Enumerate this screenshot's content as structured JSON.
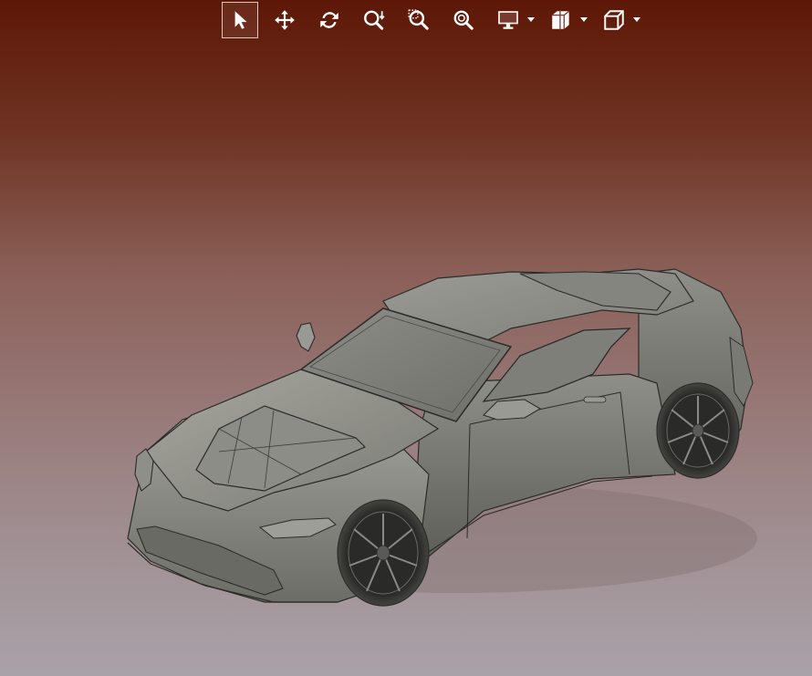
{
  "toolbar": {
    "tools": [
      {
        "id": "select",
        "icon": "cursor-icon",
        "active": true
      },
      {
        "id": "pan",
        "icon": "move-arrows-icon",
        "active": false
      },
      {
        "id": "rotate",
        "icon": "rotate-icon",
        "active": false
      },
      {
        "id": "zoom",
        "icon": "zoom-scroll-icon",
        "active": false
      },
      {
        "id": "zoom-window",
        "icon": "zoom-window-icon",
        "active": false
      },
      {
        "id": "zoom-fit",
        "icon": "zoom-fit-icon",
        "active": false
      },
      {
        "id": "display",
        "icon": "monitor-icon",
        "active": false,
        "dropdown": true
      },
      {
        "id": "section",
        "icon": "section-cube-icon",
        "active": false,
        "dropdown": true
      },
      {
        "id": "view",
        "icon": "view-cube-icon",
        "active": false,
        "dropdown": true
      }
    ]
  },
  "viewport": {
    "background_top": "#5e1706",
    "background_bottom": "#a9a2a9",
    "model": "sports-car-3d-model"
  }
}
